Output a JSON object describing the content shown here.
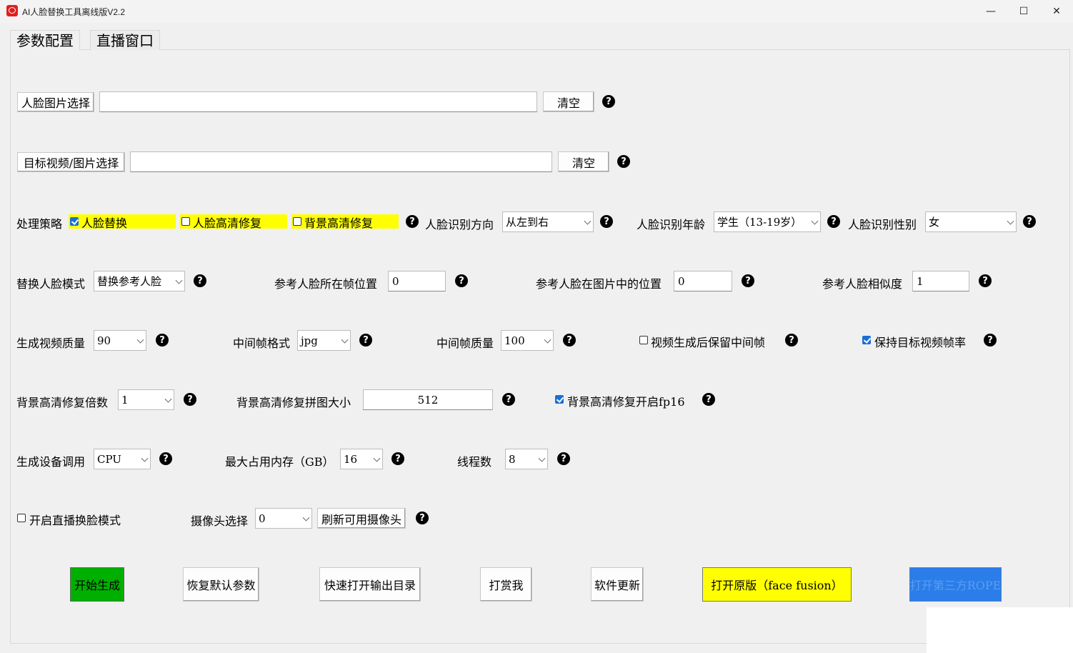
{
  "window": {
    "title": "AI人脸替换工具离线版V2.2",
    "minimize_icon": "—",
    "maximize_icon": "☐",
    "close_icon": "✕"
  },
  "tabs": [
    {
      "label": "参数配置",
      "active": true
    },
    {
      "label": "直播窗口",
      "active": false
    }
  ],
  "face_image": {
    "button": "人脸图片选择",
    "value": "",
    "clear": "清空"
  },
  "target": {
    "button": "目标视频/图片选择",
    "value": "",
    "clear": "清空"
  },
  "strategy": {
    "label": "处理策略",
    "options": [
      {
        "label": "人脸替换",
        "checked": true
      },
      {
        "label": "人脸高清修复",
        "checked": false
      },
      {
        "label": "背景高清修复",
        "checked": false
      }
    ],
    "highlight_color": "#ffff00"
  },
  "direction": {
    "label": "人脸识别方向",
    "value": "从左到右"
  },
  "age": {
    "label": "人脸识别年龄",
    "value": "学生（13-19岁）"
  },
  "gender": {
    "label": "人脸识别性别",
    "value": "女"
  },
  "replace_mode": {
    "label": "替换人脸模式",
    "value": "替换参考人脸"
  },
  "ref_frame": {
    "label": "参考人脸所在帧位置",
    "value": "0"
  },
  "ref_pos": {
    "label": "参考人脸在图片中的位置",
    "value": "0"
  },
  "ref_similarity": {
    "label": "参考人脸相似度",
    "value": "1"
  },
  "video_quality": {
    "label": "生成视频质量",
    "value": "90"
  },
  "frame_format": {
    "label": "中间帧格式",
    "value": "jpg"
  },
  "frame_quality": {
    "label": "中间帧质量",
    "value": "100"
  },
  "keep_frames": {
    "label": "视频生成后保留中间帧",
    "checked": false
  },
  "keep_fps": {
    "label": "保持目标视频帧率",
    "checked": true
  },
  "bg_scale": {
    "label": "背景高清修复倍数",
    "value": "1"
  },
  "bg_tile": {
    "label": "背景高清修复拼图大小",
    "value": "512"
  },
  "bg_fp16": {
    "label": "背景高清修复开启fp16",
    "checked": true
  },
  "device": {
    "label": "生成设备调用",
    "value": "CPU"
  },
  "memory": {
    "label": "最大占用内存（GB）",
    "value": "16"
  },
  "threads": {
    "label": "线程数",
    "value": "8"
  },
  "live": {
    "label": "开启直播换脸模式",
    "checked": false
  },
  "camera": {
    "label": "摄像头选择",
    "value": "0",
    "refresh": "刷新可用摄像头"
  },
  "help_glyph": "?",
  "actions": [
    {
      "label": "开始生成",
      "color": "#00b000"
    },
    {
      "label": "恢复默认参数",
      "color": "#fdfdfd"
    },
    {
      "label": "快速打开输出目录",
      "color": "#fdfdfd"
    },
    {
      "label": "打赏我",
      "color": "#fdfdfd"
    },
    {
      "label": "软件更新",
      "color": "#fdfdfd"
    },
    {
      "label": "打开原版（face fusion）",
      "color": "#ffff00"
    },
    {
      "label": "打开第三方ROPE",
      "color": "#2b7de9"
    }
  ]
}
